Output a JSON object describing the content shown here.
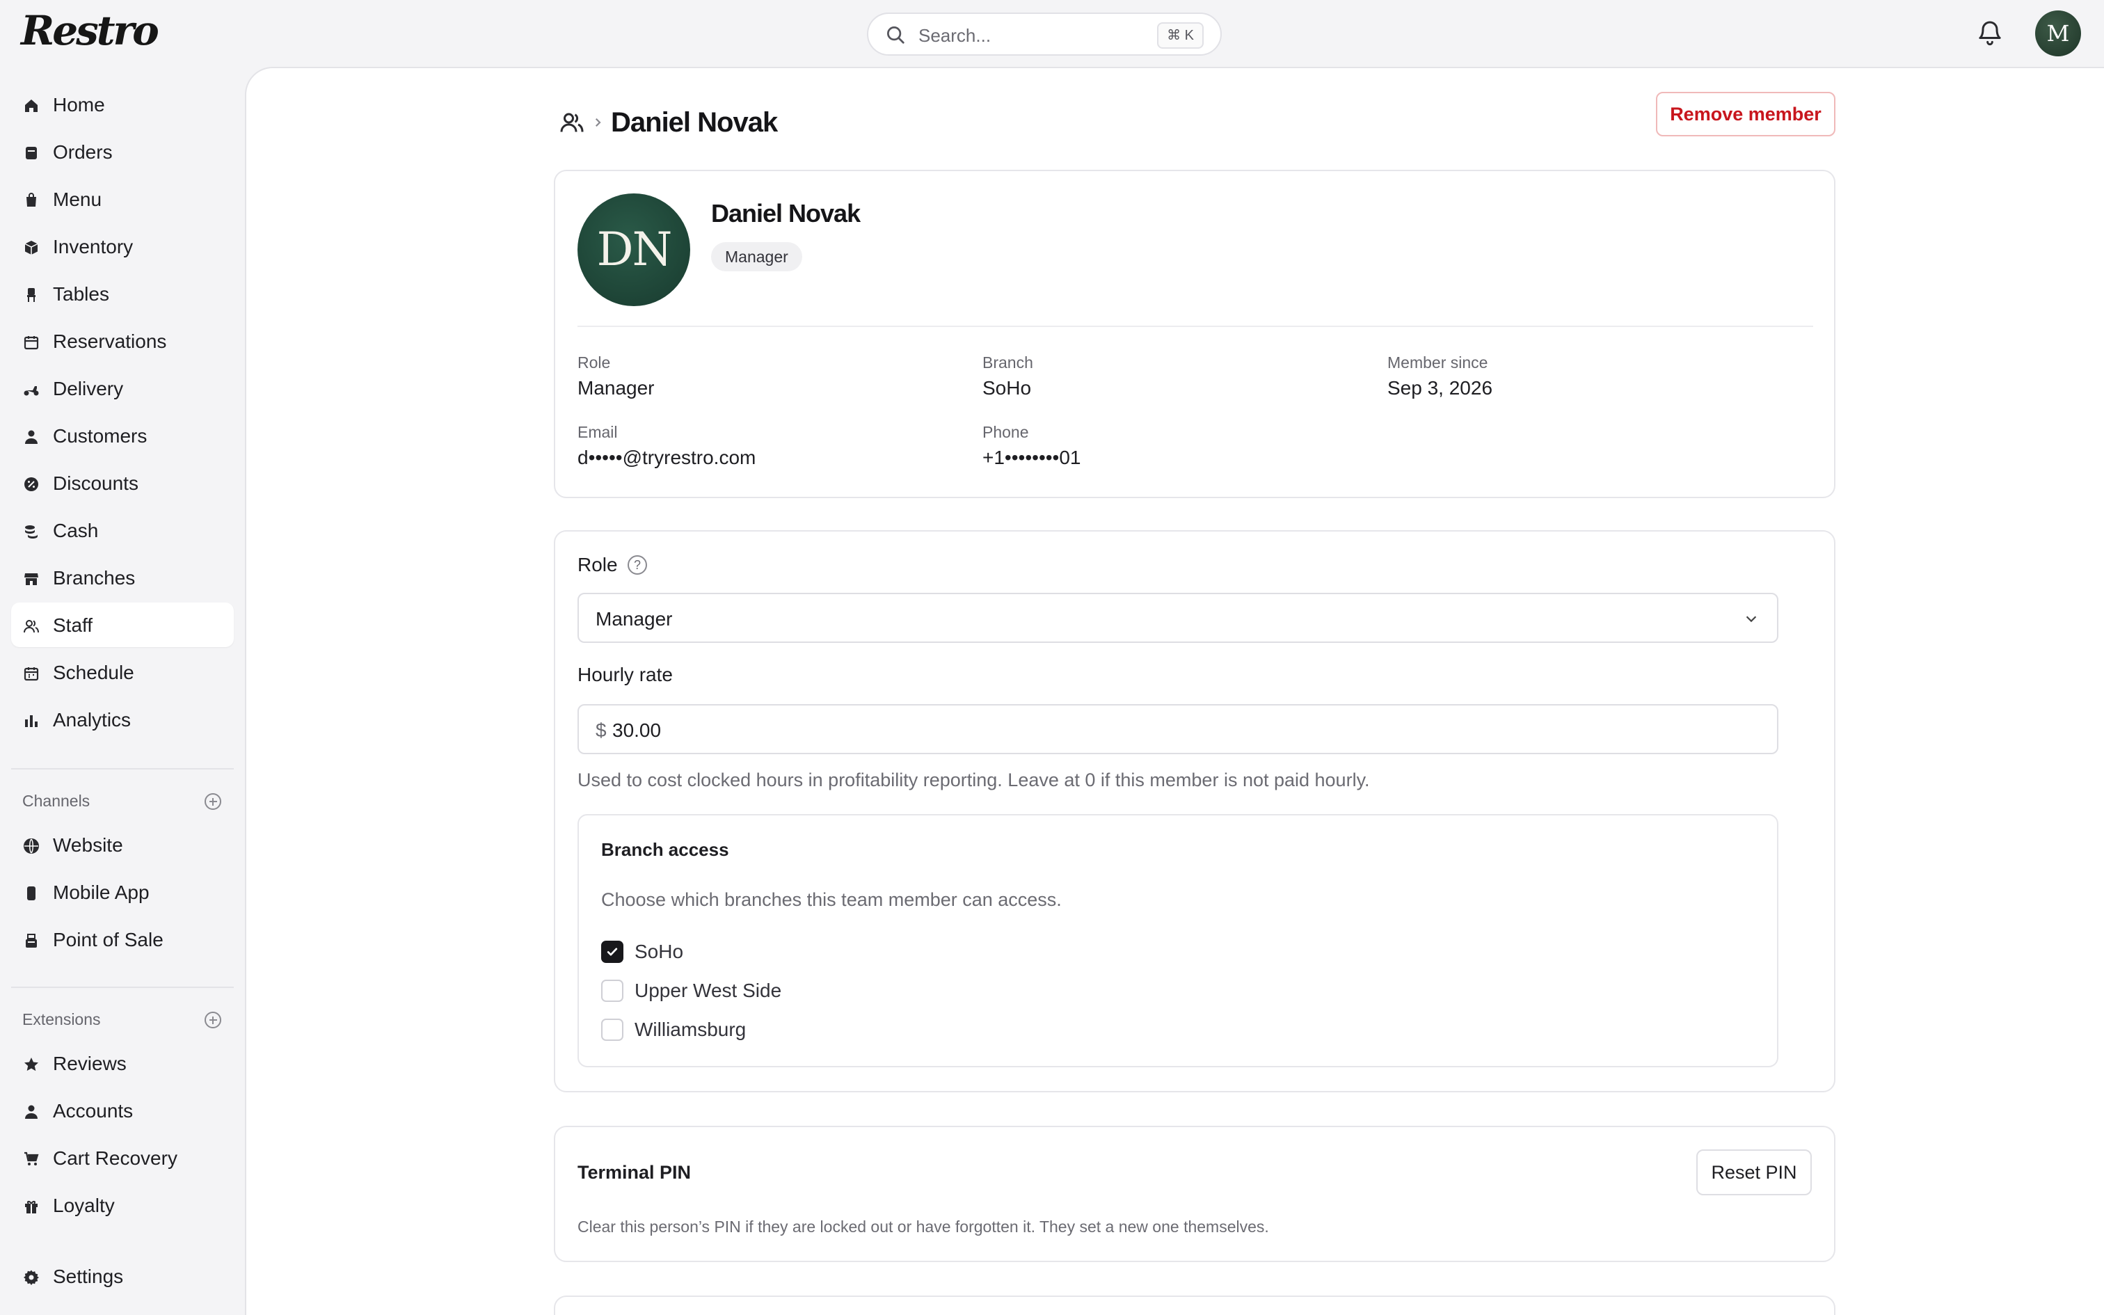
{
  "app": {
    "logo": "Restro"
  },
  "header": {
    "search_placeholder": "Search...",
    "search_shortcut": "⌘ K",
    "user_initial": "M"
  },
  "sidebar": {
    "items": [
      {
        "label": "Home",
        "icon": "home-icon"
      },
      {
        "label": "Orders",
        "icon": "orders-icon"
      },
      {
        "label": "Menu",
        "icon": "menu-icon"
      },
      {
        "label": "Inventory",
        "icon": "inventory-icon"
      },
      {
        "label": "Tables",
        "icon": "chair-icon"
      },
      {
        "label": "Reservations",
        "icon": "calendar-icon"
      },
      {
        "label": "Delivery",
        "icon": "scooter-icon"
      },
      {
        "label": "Customers",
        "icon": "person-icon"
      },
      {
        "label": "Discounts",
        "icon": "discount-icon"
      },
      {
        "label": "Cash",
        "icon": "coins-icon"
      },
      {
        "label": "Branches",
        "icon": "store-icon"
      },
      {
        "label": "Staff",
        "icon": "staff-icon",
        "active": true
      },
      {
        "label": "Schedule",
        "icon": "calendar-grid-icon"
      },
      {
        "label": "Analytics",
        "icon": "bar-chart-icon"
      }
    ],
    "channels_heading": "Channels",
    "channels": [
      {
        "label": "Website",
        "icon": "globe-icon"
      },
      {
        "label": "Mobile App",
        "icon": "phone-icon"
      },
      {
        "label": "Point of Sale",
        "icon": "pos-icon"
      }
    ],
    "extensions_heading": "Extensions",
    "extensions": [
      {
        "label": "Reviews",
        "icon": "star-icon"
      },
      {
        "label": "Accounts",
        "icon": "person-icon"
      },
      {
        "label": "Cart Recovery",
        "icon": "cart-icon"
      },
      {
        "label": "Loyalty",
        "icon": "gift-icon"
      }
    ],
    "settings": {
      "label": "Settings",
      "icon": "gear-icon"
    }
  },
  "page": {
    "title": "Daniel Novak",
    "remove_button": "Remove member"
  },
  "profile": {
    "initials": "DN",
    "name": "Daniel Novak",
    "badge": "Manager",
    "fields": {
      "role_label": "Role",
      "role_value": "Manager",
      "branch_label": "Branch",
      "branch_value": "SoHo",
      "since_label": "Member since",
      "since_value": "Sep 3, 2026",
      "email_label": "Email",
      "email_value": "d•••••@tryrestro.com",
      "phone_label": "Phone",
      "phone_value": "+1••••••••01"
    }
  },
  "settings_form": {
    "role_label": "Role",
    "role_selected": "Manager",
    "rate_label": "Hourly rate",
    "rate_prefix": "$",
    "rate_value": "30.00",
    "rate_help": "Used to cost clocked hours in profitability reporting. Leave at 0 if this member is not paid hourly.",
    "branch_access": {
      "title": "Branch access",
      "description": "Choose which branches this team member can access.",
      "options": [
        {
          "label": "SoHo",
          "checked": true
        },
        {
          "label": "Upper West Side",
          "checked": false
        },
        {
          "label": "Williamsburg",
          "checked": false
        }
      ]
    }
  },
  "pin": {
    "title": "Terminal PIN",
    "button": "Reset PIN",
    "description": "Clear this person’s PIN if they are locked out or have forgotten it. They set a new one themselves."
  },
  "colors": {
    "danger": "#c8161d",
    "avatar_green": "#1f4a3b",
    "accent_dark": "#18181b"
  }
}
